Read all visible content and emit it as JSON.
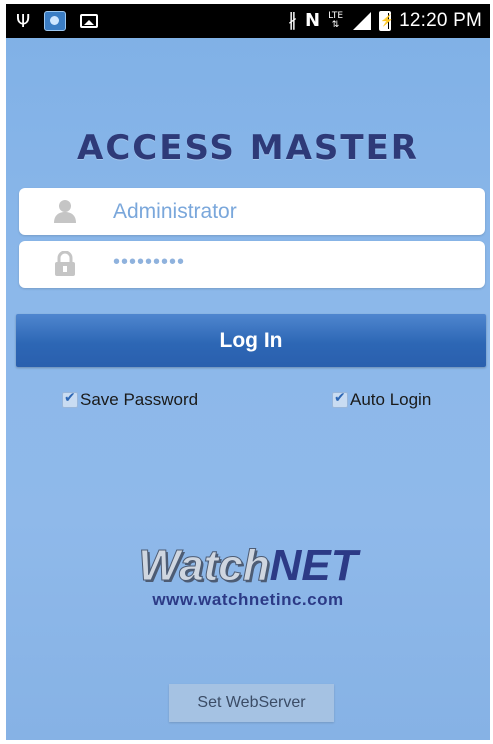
{
  "status_bar": {
    "time": "12:20 PM",
    "icons": [
      "usb-icon",
      "app-notification-icon",
      "image-icon",
      "bluetooth-icon",
      "nfc-icon",
      "lte-icon",
      "signal-icon",
      "battery-icon"
    ],
    "lte_label": "LTE"
  },
  "app": {
    "title": "ACCESS MASTER"
  },
  "form": {
    "username_value": "Administrator",
    "password_value": "•••••••••",
    "login_label": "Log In",
    "save_password_label": "Save Password",
    "save_password_checked": true,
    "auto_login_label": "Auto Login",
    "auto_login_checked": true
  },
  "branding": {
    "logo_watch": "Watch",
    "logo_net": "NET",
    "url": "www.watchnetinc.com"
  },
  "footer": {
    "set_webserver_label": "Set WebServer"
  },
  "colors": {
    "background": "#8cb8ea",
    "title": "#2e3a78",
    "button": "#2d67b5",
    "brand": "#2c3a86"
  }
}
